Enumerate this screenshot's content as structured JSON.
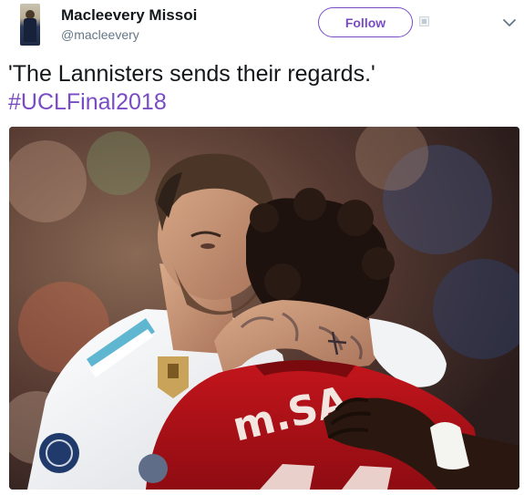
{
  "tweet": {
    "author": {
      "display_name": "Macleevery Missoi",
      "handle": "@macleevery"
    },
    "follow_label": "Follow",
    "text_line1": "'The Lannisters sends their regards.'",
    "hashtag": "#UCLFinal2018",
    "media": {
      "jersey_text": "m.SA"
    }
  },
  "colors": {
    "accent": "#794bc4",
    "text": "#14171a",
    "secondary": "#657786"
  },
  "icons": {
    "caret": "chevron-down-icon",
    "badge": "follow-badge-icon"
  }
}
